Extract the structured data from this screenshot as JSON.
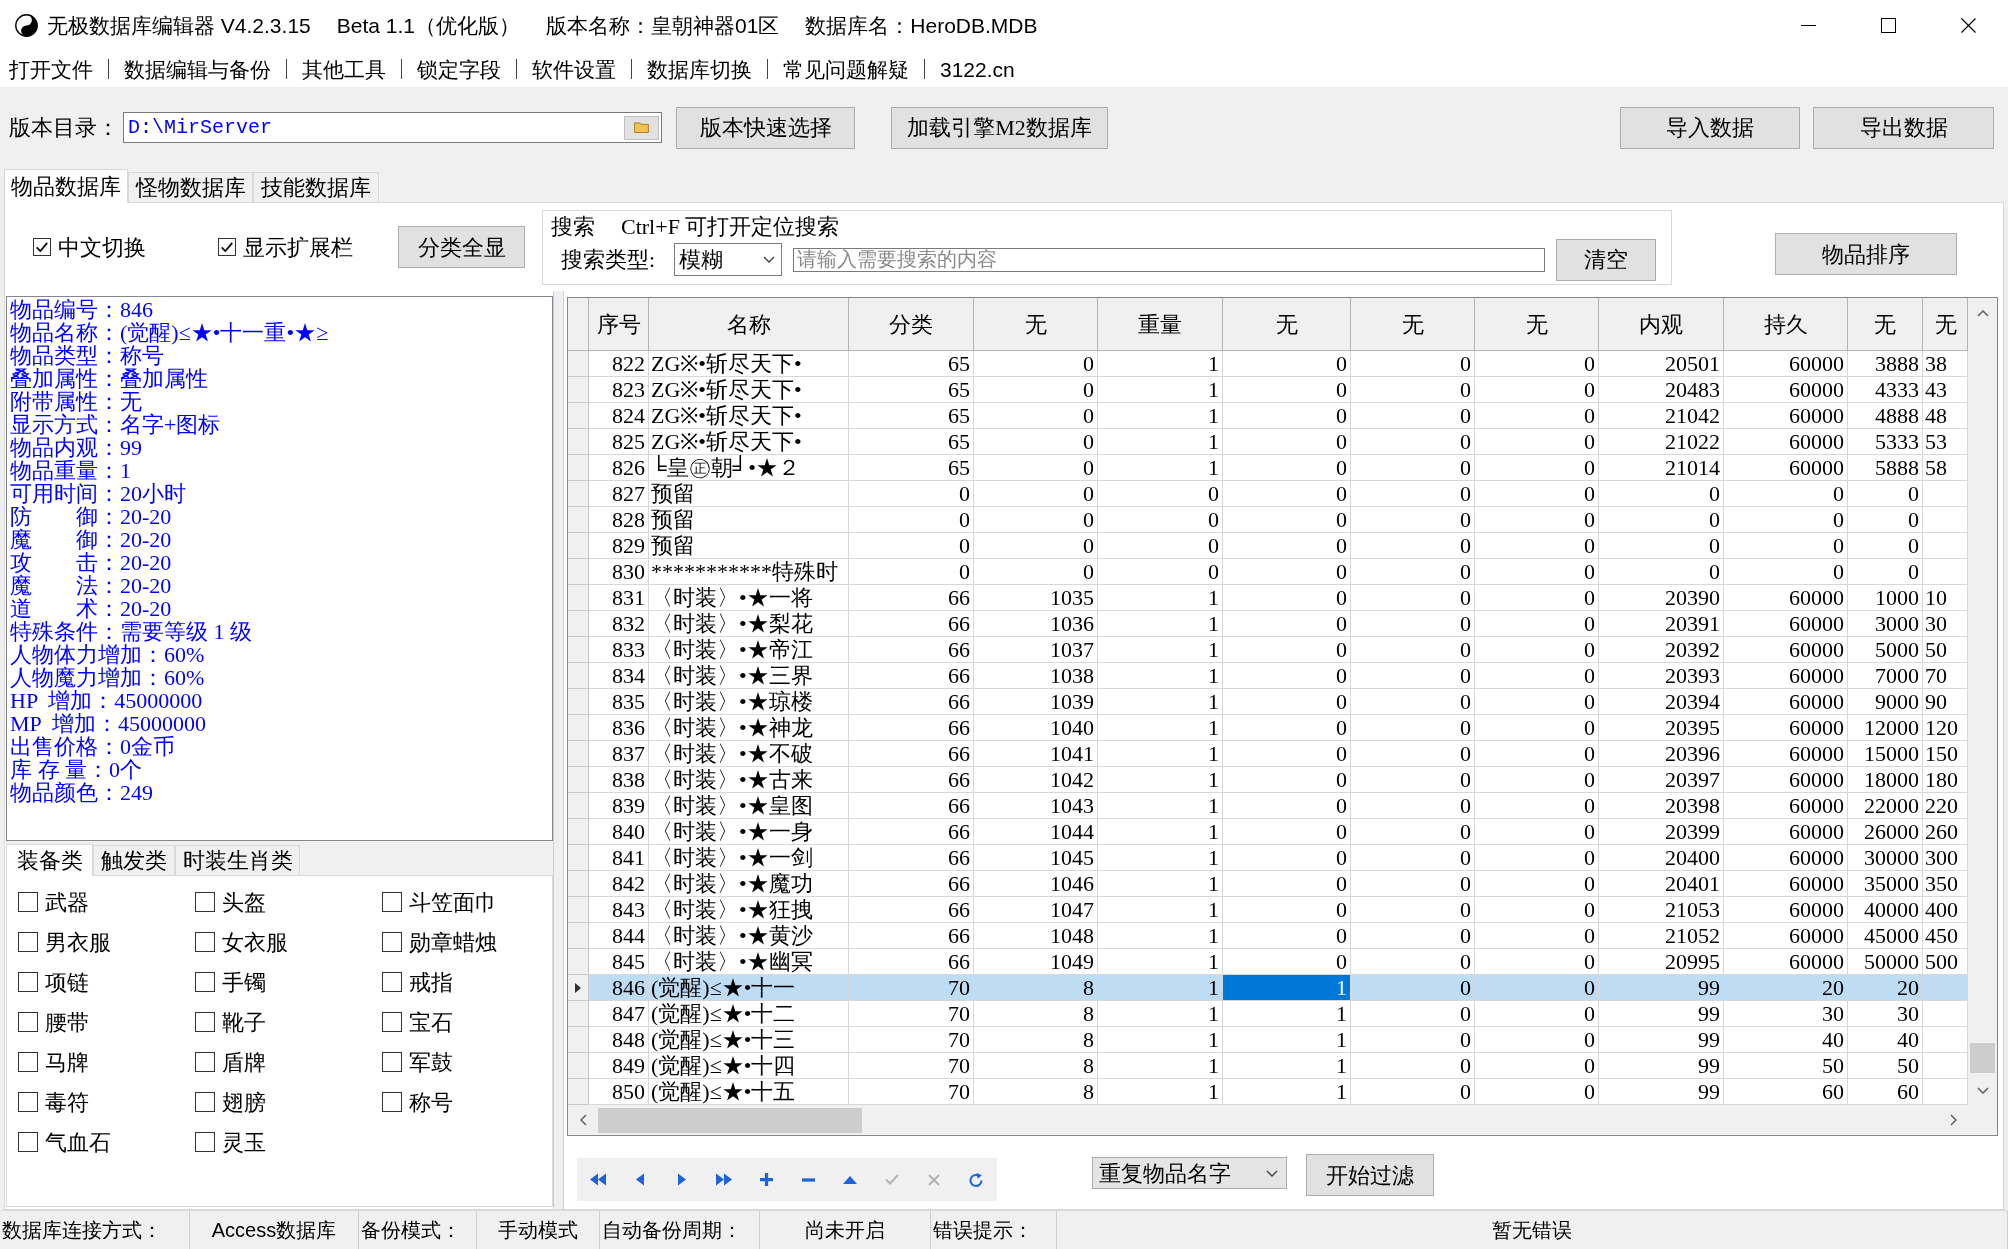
{
  "window": {
    "title_parts": [
      "无极数据库编辑器 V4.2.3.15",
      "Beta 1.1（优化版）",
      "版本名称：皇朝神器01区",
      "数据库名：HeroDB.MDB"
    ]
  },
  "menu": [
    "打开文件",
    "数据编辑与备份",
    "其他工具",
    "锁定字段",
    "软件设置",
    "数据库切换",
    "常见问题解疑",
    "3122.cn"
  ],
  "toolbar": {
    "directory_label": "版本目录：",
    "directory": {
      "value": "D:\\MirServer"
    },
    "buttons": [
      "版本快速选择",
      "加载引擎M2数据库",
      "导入数据",
      "导出数据"
    ]
  },
  "tabs": [
    {
      "label": "物品数据库",
      "selected": true
    },
    {
      "label": "怪物数据库",
      "selected": false
    },
    {
      "label": "技能数据库",
      "selected": false
    }
  ],
  "options": {
    "checkboxes": [
      {
        "label": "中文切换",
        "checked": true
      },
      {
        "label": "显示扩展栏",
        "checked": true
      }
    ],
    "show_all_button": "分类全显"
  },
  "search": {
    "title": "搜索",
    "hint": "Ctrl+F 可打开定位搜索",
    "type_label": "搜索类型:",
    "type_value": "模糊",
    "placeholder": "请输入需要搜索的内容",
    "clear_button": "清空"
  },
  "sort_button": "物品排序",
  "details": {
    "lines": [
      "物品编号：846",
      "物品名称：(觉醒)≤★•十一重•★≥",
      "物品类型：称号",
      "叠加属性：叠加属性",
      "附带属性：无",
      "显示方式：名字+图标",
      "物品内观：99",
      "物品重量：1",
      "可用时间：20小时",
      "防　　御：20-20",
      "魔　　御：20-20",
      "攻　　击：20-20",
      "魔　　法：20-20",
      "道　　术：20-20",
      "特殊条件：需要等级 1 级",
      "人物体力增加：60%",
      "人物魔力增加：60%",
      "HP  增加：45000000",
      "MP  增加：45000000",
      "出售价格：0金币",
      "库 存 量：0个",
      "物品颜色：249"
    ]
  },
  "category_tabs": [
    {
      "label": "装备类",
      "selected": true
    },
    {
      "label": "触发类",
      "selected": false
    },
    {
      "label": "时装生肖类",
      "selected": false
    }
  ],
  "categories": [
    {
      "label": "武器",
      "checked": false
    },
    {
      "label": "头盔",
      "checked": false
    },
    {
      "label": "斗笠面巾",
      "checked": false
    },
    {
      "label": "男衣服",
      "checked": false
    },
    {
      "label": "女衣服",
      "checked": false
    },
    {
      "label": "勋章蜡烛",
      "checked": false
    },
    {
      "label": "项链",
      "checked": false
    },
    {
      "label": "手镯",
      "checked": false
    },
    {
      "label": "戒指",
      "checked": false
    },
    {
      "label": "腰带",
      "checked": false
    },
    {
      "label": "靴子",
      "checked": false
    },
    {
      "label": "宝石",
      "checked": false
    },
    {
      "label": "马牌",
      "checked": false
    },
    {
      "label": "盾牌",
      "checked": false
    },
    {
      "label": "军鼓",
      "checked": false
    },
    {
      "label": "毒符",
      "checked": false
    },
    {
      "label": "翅膀",
      "checked": false
    },
    {
      "label": "称号",
      "checked": false
    },
    {
      "label": "气血石",
      "checked": false
    },
    {
      "label": "灵玉",
      "checked": false
    }
  ],
  "table": {
    "columns": [
      {
        "label": "序号",
        "selected": false
      },
      {
        "label": "名称",
        "selected": false
      },
      {
        "label": "分类",
        "selected": false
      },
      {
        "label": "无",
        "selected": false
      },
      {
        "label": "重量",
        "selected": false
      },
      {
        "label": "无",
        "selected": true
      },
      {
        "label": "无",
        "selected": false
      },
      {
        "label": "无",
        "selected": false
      },
      {
        "label": "内观",
        "selected": false
      },
      {
        "label": "持久",
        "selected": false
      },
      {
        "label": "无",
        "selected": false
      },
      {
        "label": "无",
        "selected": false
      }
    ],
    "rows": [
      {
        "selected": false,
        "cells": [
          "822",
          "ZG※•斩尽天下•",
          "65",
          "0",
          "1",
          "0",
          "0",
          "0",
          "20501",
          "60000",
          "3888",
          "38"
        ]
      },
      {
        "selected": false,
        "cells": [
          "823",
          "ZG※•斩尽天下•",
          "65",
          "0",
          "1",
          "0",
          "0",
          "0",
          "20483",
          "60000",
          "4333",
          "43"
        ]
      },
      {
        "selected": false,
        "cells": [
          "824",
          "ZG※•斩尽天下•",
          "65",
          "0",
          "1",
          "0",
          "0",
          "0",
          "21042",
          "60000",
          "4888",
          "48"
        ]
      },
      {
        "selected": false,
        "cells": [
          "825",
          "ZG※•斩尽天下•",
          "65",
          "0",
          "1",
          "0",
          "0",
          "0",
          "21022",
          "60000",
          "5333",
          "53"
        ]
      },
      {
        "selected": false,
        "cells": [
          "826",
          "╘皇㊣朝╛•★２",
          "65",
          "0",
          "1",
          "0",
          "0",
          "0",
          "21014",
          "60000",
          "5888",
          "58"
        ]
      },
      {
        "selected": false,
        "cells": [
          "827",
          "预留",
          "0",
          "0",
          "0",
          "0",
          "0",
          "0",
          "0",
          "0",
          "0"
        ]
      },
      {
        "selected": false,
        "cells": [
          "828",
          "预留",
          "0",
          "0",
          "0",
          "0",
          "0",
          "0",
          "0",
          "0",
          "0"
        ]
      },
      {
        "selected": false,
        "cells": [
          "829",
          "预留",
          "0",
          "0",
          "0",
          "0",
          "0",
          "0",
          "0",
          "0",
          "0"
        ]
      },
      {
        "selected": false,
        "cells": [
          "830",
          "***********特殊时",
          "0",
          "0",
          "0",
          "0",
          "0",
          "0",
          "0",
          "0",
          "0"
        ]
      },
      {
        "selected": false,
        "cells": [
          "831",
          "〈时装〉•★一将",
          "66",
          "1035",
          "1",
          "0",
          "0",
          "0",
          "20390",
          "60000",
          "1000",
          "10"
        ]
      },
      {
        "selected": false,
        "cells": [
          "832",
          "〈时装〉•★梨花",
          "66",
          "1036",
          "1",
          "0",
          "0",
          "0",
          "20391",
          "60000",
          "3000",
          "30"
        ]
      },
      {
        "selected": false,
        "cells": [
          "833",
          "〈时装〉•★帝江",
          "66",
          "1037",
          "1",
          "0",
          "0",
          "0",
          "20392",
          "60000",
          "5000",
          "50"
        ]
      },
      {
        "selected": false,
        "cells": [
          "834",
          "〈时装〉•★三界",
          "66",
          "1038",
          "1",
          "0",
          "0",
          "0",
          "20393",
          "60000",
          "7000",
          "70"
        ]
      },
      {
        "selected": false,
        "cells": [
          "835",
          "〈时装〉•★琼楼",
          "66",
          "1039",
          "1",
          "0",
          "0",
          "0",
          "20394",
          "60000",
          "9000",
          "90"
        ]
      },
      {
        "selected": false,
        "cells": [
          "836",
          "〈时装〉•★神龙",
          "66",
          "1040",
          "1",
          "0",
          "0",
          "0",
          "20395",
          "60000",
          "12000",
          "120"
        ]
      },
      {
        "selected": false,
        "cells": [
          "837",
          "〈时装〉•★不破",
          "66",
          "1041",
          "1",
          "0",
          "0",
          "0",
          "20396",
          "60000",
          "15000",
          "150"
        ]
      },
      {
        "selected": false,
        "cells": [
          "838",
          "〈时装〉•★古来",
          "66",
          "1042",
          "1",
          "0",
          "0",
          "0",
          "20397",
          "60000",
          "18000",
          "180"
        ]
      },
      {
        "selected": false,
        "cells": [
          "839",
          "〈时装〉•★皇图",
          "66",
          "1043",
          "1",
          "0",
          "0",
          "0",
          "20398",
          "60000",
          "22000",
          "220"
        ]
      },
      {
        "selected": false,
        "cells": [
          "840",
          "〈时装〉•★一身",
          "66",
          "1044",
          "1",
          "0",
          "0",
          "0",
          "20399",
          "60000",
          "26000",
          "260"
        ]
      },
      {
        "selected": false,
        "cells": [
          "841",
          "〈时装〉•★一剑",
          "66",
          "1045",
          "1",
          "0",
          "0",
          "0",
          "20400",
          "60000",
          "30000",
          "300"
        ]
      },
      {
        "selected": false,
        "cells": [
          "842",
          "〈时装〉•★魔功",
          "66",
          "1046",
          "1",
          "0",
          "0",
          "0",
          "20401",
          "60000",
          "35000",
          "350"
        ]
      },
      {
        "selected": false,
        "cells": [
          "843",
          "〈时装〉•★狂拽",
          "66",
          "1047",
          "1",
          "0",
          "0",
          "0",
          "21053",
          "60000",
          "40000",
          "400"
        ]
      },
      {
        "selected": false,
        "cells": [
          "844",
          "〈时装〉•★黄沙",
          "66",
          "1048",
          "1",
          "0",
          "0",
          "0",
          "21052",
          "60000",
          "45000",
          "450"
        ]
      },
      {
        "selected": false,
        "cells": [
          "845",
          "〈时装〉•★幽冥",
          "66",
          "1049",
          "1",
          "0",
          "0",
          "0",
          "20995",
          "60000",
          "50000",
          "500"
        ]
      },
      {
        "selected": true,
        "cells": [
          "846",
          "(觉醒)≤★•十一",
          "70",
          "8",
          "1",
          "1",
          "0",
          "0",
          "99",
          "20",
          "20"
        ]
      },
      {
        "selected": false,
        "cells": [
          "847",
          "(觉醒)≤★•十二",
          "70",
          "8",
          "1",
          "1",
          "0",
          "0",
          "99",
          "30",
          "30"
        ]
      },
      {
        "selected": false,
        "cells": [
          "848",
          "(觉醒)≤★•十三",
          "70",
          "8",
          "1",
          "1",
          "0",
          "0",
          "99",
          "40",
          "40"
        ]
      },
      {
        "selected": false,
        "cells": [
          "849",
          "(觉醒)≤★•十四",
          "70",
          "8",
          "1",
          "1",
          "0",
          "0",
          "99",
          "50",
          "50"
        ]
      },
      {
        "selected": false,
        "cells": [
          "850",
          "(觉醒)≤★•十五",
          "70",
          "8",
          "1",
          "1",
          "0",
          "0",
          "99",
          "60",
          "60"
        ]
      }
    ]
  },
  "navigator": [
    {
      "kind": "first",
      "disabled": false
    },
    {
      "kind": "prior",
      "disabled": false
    },
    {
      "kind": "next",
      "disabled": false
    },
    {
      "kind": "last",
      "disabled": false
    },
    {
      "kind": "insert",
      "disabled": false
    },
    {
      "kind": "delete",
      "disabled": false
    },
    {
      "kind": "edit",
      "disabled": false
    },
    {
      "kind": "post",
      "disabled": true
    },
    {
      "kind": "cancel",
      "disabled": true
    },
    {
      "kind": "refresh",
      "disabled": false
    }
  ],
  "filter": {
    "value": "重复物品名字",
    "button": "开始过滤"
  },
  "status_bar": [
    {
      "label": "数据库连接方式：",
      "value": "Access数据库"
    },
    {
      "label": "备份模式：",
      "value": "手动模式"
    },
    {
      "label": "自动备份周期：",
      "value": "尚未开启"
    },
    {
      "label": "错误提示：",
      "value": "暂无错误"
    }
  ]
}
